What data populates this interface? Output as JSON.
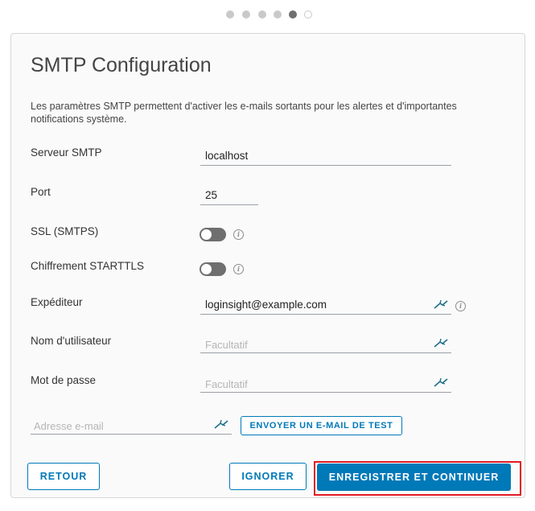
{
  "wizard": {
    "total_steps": 6,
    "current_step": 5
  },
  "title": "SMTP Configuration",
  "description": "Les paramètres SMTP permettent d'activer les e-mails sortants pour les alertes et d'importantes notifications système.",
  "fields": {
    "server": {
      "label": "Serveur SMTP",
      "value": "localhost"
    },
    "port": {
      "label": "Port",
      "value": "25"
    },
    "ssl": {
      "label": "SSL (SMTPS)",
      "enabled": false
    },
    "starttls": {
      "label": "Chiffrement STARTTLS",
      "enabled": false
    },
    "sender": {
      "label": "Expéditeur",
      "value": "loginsight@example.com"
    },
    "username": {
      "label": "Nom d'utilisateur",
      "placeholder": "Facultatif"
    },
    "password": {
      "label": "Mot de passe",
      "placeholder": "Facultatif"
    }
  },
  "test": {
    "email_placeholder": "Adresse e-mail",
    "send_button": "ENVOYER UN E-MAIL DE TEST"
  },
  "buttons": {
    "back": "RETOUR",
    "skip": "IGNORER",
    "save": "ENREGISTRER ET CONTINUER"
  },
  "colors": {
    "accent": "#0079b8",
    "highlight": "#e21b23"
  }
}
